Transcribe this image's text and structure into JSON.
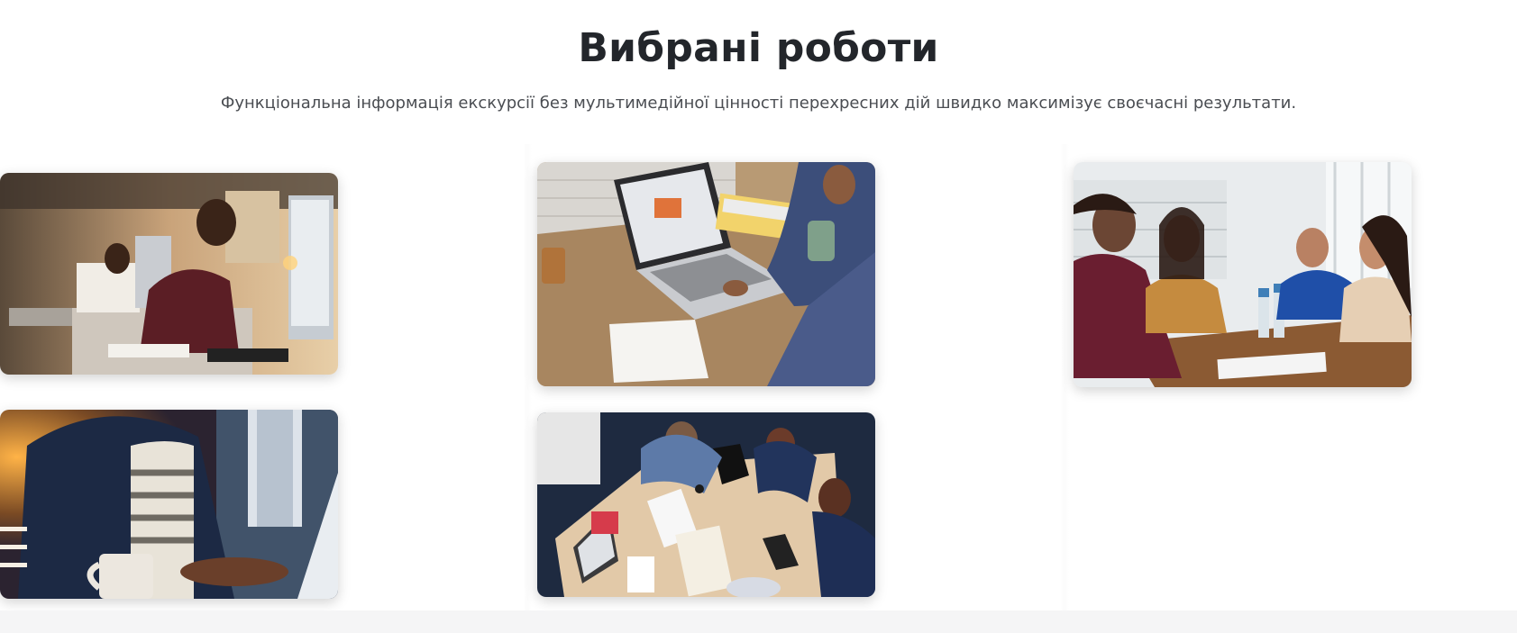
{
  "section": {
    "title": "Вибрані роботи",
    "subtitle": "Функціональна інформація екскурсії без мультимедійної цінності перехресних дій швидко максимізує своєчасні результати."
  },
  "gallery": [
    {
      "alt": "Втомлений працівник за комп'ютером в офісі"
    },
    {
      "alt": "Ноутбук на дерев'яному столі"
    },
    {
      "alt": "Ділова зустріч за столом"
    },
    {
      "alt": "Людина працює на ноутбуці з чашкою"
    },
    {
      "alt": "Команда працює за столом, вигляд зверху"
    }
  ],
  "colors": {
    "title": "#23262b",
    "subtitle": "#4a4d52",
    "bottom_band": "#f5f5f6"
  }
}
